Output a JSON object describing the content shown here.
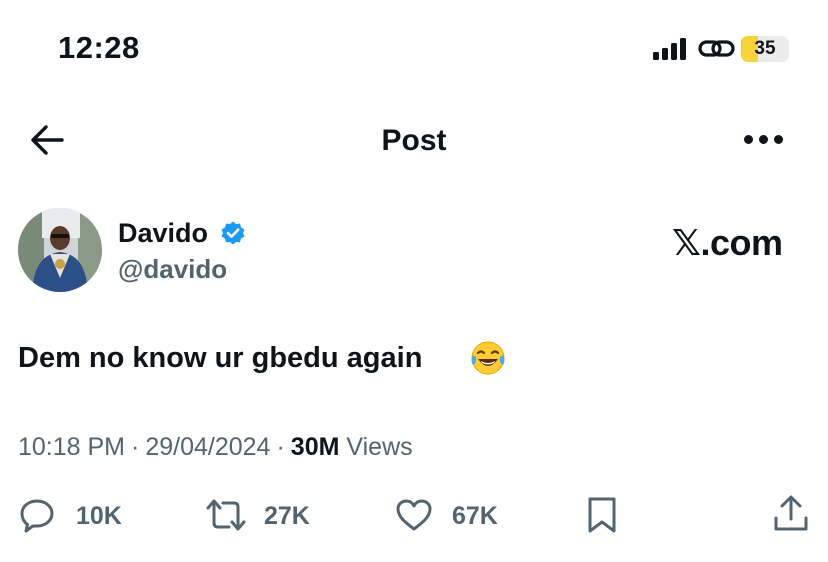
{
  "status_bar": {
    "time": "12:28",
    "battery_level": "35",
    "battery_color": "#f7d23a",
    "icons": [
      "signal-bars-icon",
      "link-icon",
      "battery-icon"
    ]
  },
  "nav": {
    "title": "Post",
    "icons": [
      "back-arrow-icon",
      "more-options-icon"
    ]
  },
  "author": {
    "name": "Davido",
    "handle": "@davido",
    "verified": true,
    "verified_color": "#1d9bf0"
  },
  "watermark": {
    "x_glyph": "𝕏",
    "domain": ".com"
  },
  "post": {
    "text": "Dem no know ur gbedu again",
    "emoji": "face-with-tears-of-joy"
  },
  "meta": {
    "time": "10:18 PM",
    "separator": "·",
    "date": "29/04/2024",
    "views_count": "30M",
    "views_label": "Views"
  },
  "actions": {
    "replies": "10K",
    "reposts": "27K",
    "likes": "67K",
    "icons": [
      "reply-icon",
      "repost-icon",
      "like-icon",
      "bookmark-icon",
      "share-icon"
    ]
  }
}
